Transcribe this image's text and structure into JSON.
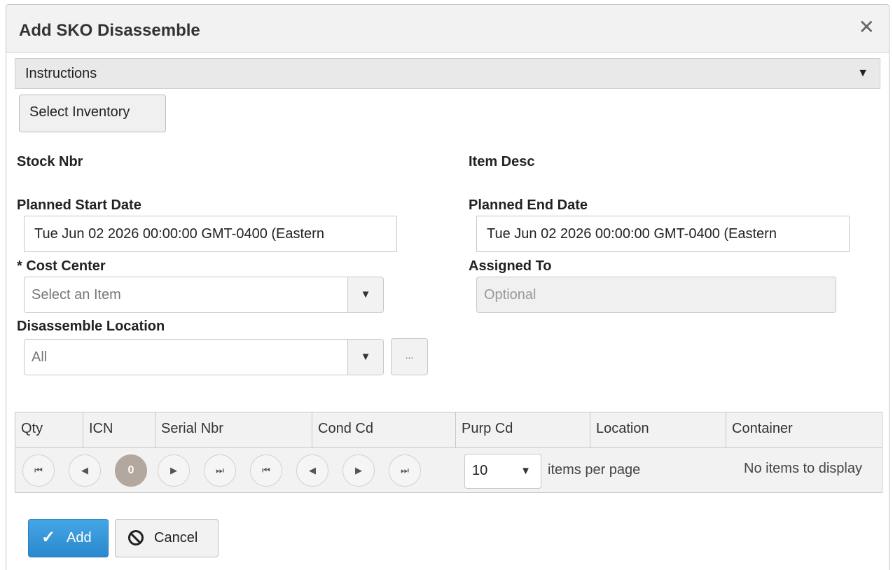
{
  "dialog": {
    "title": "Add SKO Disassemble",
    "close_glyph": "✕"
  },
  "instructions": {
    "label": "Instructions",
    "arrow_glyph": "▼"
  },
  "select_inventory": {
    "label": "Select Inventory"
  },
  "fields": {
    "stock_nbr_label": "Stock Nbr",
    "item_desc_label": "Item Desc",
    "planned_start_label": "Planned Start Date",
    "planned_start_value": "Tue Jun 02 2026 00:00:00 GMT-0400 (Eastern",
    "planned_end_label": "Planned End Date",
    "planned_end_value": "Tue Jun 02 2026 00:00:00 GMT-0400 (Eastern",
    "cost_center_label": "* Cost Center",
    "cost_center_placeholder": "Select an Item",
    "assigned_to_label": "Assigned To",
    "assigned_to_placeholder": "Optional",
    "location_label": "Disassemble Location",
    "location_value": "All",
    "dots_label": "..."
  },
  "grid": {
    "columns": [
      "Qty",
      "ICN",
      "Serial Nbr",
      "Cond Cd",
      "Purp Cd",
      "Location",
      "Container"
    ],
    "pager": {
      "first_glyph": "⏮",
      "prev_glyph": "◀",
      "current_page": "0",
      "next_glyph": "▶",
      "last_glyph": "⏭",
      "page_size": "10",
      "items_per_page_label": "items per page",
      "status": "No items to display"
    }
  },
  "actions": {
    "add_label": "Add",
    "add_glyph": "✓",
    "cancel_label": "Cancel"
  },
  "colors": {
    "primary_button": "#2a88cc",
    "current_page": "#b3a8a0"
  }
}
